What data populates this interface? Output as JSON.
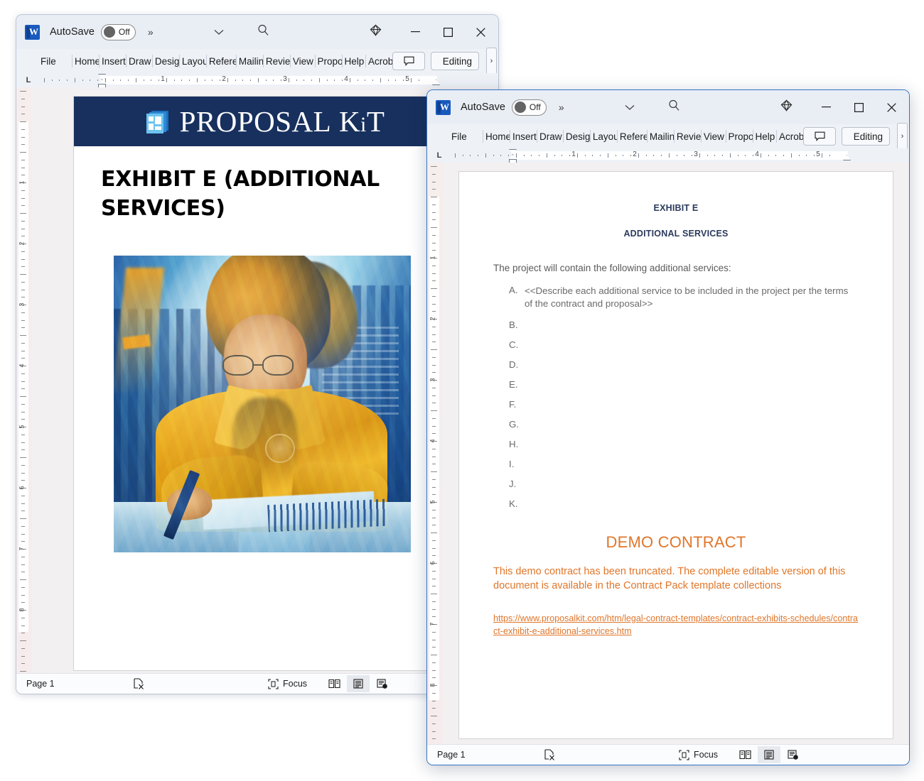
{
  "app": {
    "word_icon_letter": "W",
    "autosave_label": "AutoSave",
    "autosave_state": "Off",
    "overflow_chevron": "»",
    "dropdown_chevron": "⌄",
    "search_icon": "search-icon",
    "diamond_icon": "diamond-icon",
    "minimize_label": "─",
    "maximize_label": "☐",
    "close_label": "✕"
  },
  "ribbon": {
    "tabs": [
      "File",
      "Home",
      "Insert",
      "Draw",
      "Design",
      "Layout",
      "References",
      "Mailings",
      "Review",
      "View",
      "Proposal",
      "Help",
      "Acrobat"
    ],
    "comment_label": "",
    "editing_label": "Editing",
    "expand_chevron": "›"
  },
  "ruler": {
    "tab_stop_marker": "L",
    "h_numbers": [
      "1",
      "2",
      "3",
      "4",
      "5"
    ],
    "v_numbers": [
      "1",
      "2",
      "3",
      "4",
      "5",
      "6",
      "7",
      "8"
    ]
  },
  "status": {
    "page_label": "Page 1",
    "proofing_icon": "proofing-errors-icon",
    "focus_label": "Focus",
    "views": [
      {
        "name": "read-mode-view-icon",
        "active": false
      },
      {
        "name": "print-layout-view-icon",
        "active": true
      },
      {
        "name": "web-layout-view-icon",
        "active": false
      }
    ]
  },
  "window_back": {
    "document": {
      "banner": {
        "brand_main": "PROPOSAL",
        "brand_sub": "KIT",
        "brand_k": "K",
        "brand_i": "i",
        "brand_t": "T",
        "bg_color": "#17305e",
        "logo_icon": "proposal-kit-logo-icon"
      },
      "title": "EXHIBIT E (ADDITIONAL SERVICES)",
      "image_alt": "illustration-woman-writing-at-desk-with-city-backdrop"
    }
  },
  "window_front": {
    "document": {
      "heading_1": "EXHIBIT E",
      "heading_2": "ADDITIONAL SERVICES",
      "intro": "The project will contain the following additional services:",
      "list": [
        {
          "marker": "A.",
          "text": "<<Describe each additional service to be included in the project per the terms of the contract and proposal>>"
        },
        {
          "marker": "B.",
          "text": ""
        },
        {
          "marker": "C.",
          "text": ""
        },
        {
          "marker": "D.",
          "text": ""
        },
        {
          "marker": "E.",
          "text": ""
        },
        {
          "marker": "F.",
          "text": ""
        },
        {
          "marker": "G.",
          "text": ""
        },
        {
          "marker": "H.",
          "text": ""
        },
        {
          "marker": "I.",
          "text": ""
        },
        {
          "marker": "J.",
          "text": ""
        },
        {
          "marker": "K.",
          "text": ""
        }
      ],
      "demo_heading": "DEMO CONTRACT",
      "demo_paragraph": "This demo contract has been truncated. The complete editable version of this document is available in the Contract Pack template collections",
      "demo_link": "https://www.proposalkit.com/htm/legal-contract-templates/contract-exhibits-schedules/contract-exhibit-e-additional-services.htm",
      "accent_color": "#e0762a",
      "heading_color": "#2b3a5c"
    }
  }
}
